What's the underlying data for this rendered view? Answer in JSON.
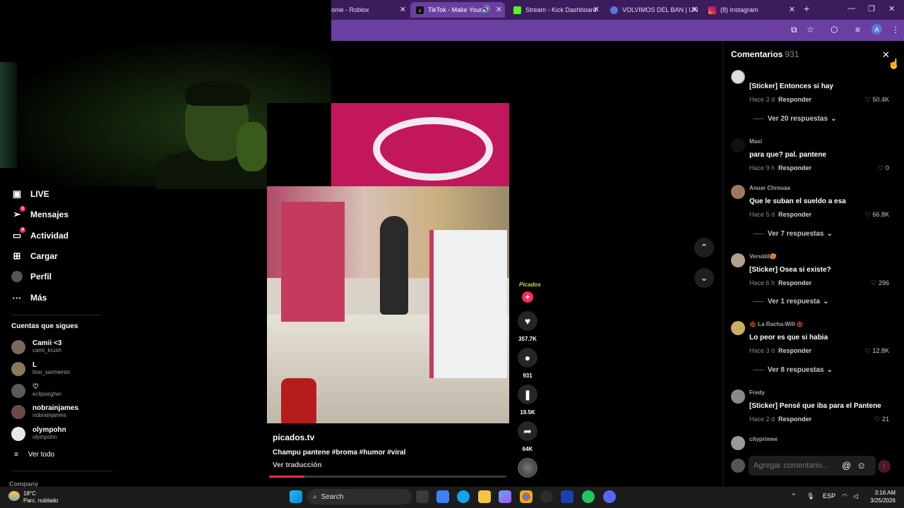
{
  "browser": {
    "tabs": [
      {
        "label": "ome - Roblox",
        "active": false
      },
      {
        "label": "TikTok - Make Your D",
        "active": true
      },
      {
        "label": "Stream - Kick Dashboard",
        "active": false
      },
      {
        "label": "VOLVIMOS DEL BAN | UN",
        "active": false
      },
      {
        "label": "(8) Instagram",
        "active": false
      }
    ],
    "new_tab": "+",
    "profile_initial": "A"
  },
  "sidebar": {
    "items": [
      {
        "label": "LIVE",
        "icon": "live-icon",
        "badge": ""
      },
      {
        "label": "Mensajes",
        "icon": "messages-icon",
        "badge": "1"
      },
      {
        "label": "Actividad",
        "icon": "activity-icon",
        "badge": "4"
      },
      {
        "label": "Cargar",
        "icon": "upload-icon",
        "badge": ""
      },
      {
        "label": "Perfil",
        "icon": "profile-icon",
        "badge": ""
      },
      {
        "label": "Más",
        "icon": "more-icon",
        "badge": ""
      }
    ],
    "following_title": "Cuentas que sigues",
    "following": [
      {
        "name": "Camii <3",
        "username": "cami_krush"
      },
      {
        "name": "L",
        "username": "lissi_sarmiento"
      },
      {
        "name": "♡",
        "username": "eclipsegher"
      },
      {
        "name": "nobrainjames",
        "username": "nobrainjames"
      },
      {
        "name": "olympohn",
        "username": "olympohn"
      }
    ],
    "see_all": "Ver todo",
    "company": "Company"
  },
  "video": {
    "author": "picados.tv",
    "caption": "Champu pantene #broma #humor #viral",
    "translate": "Ver traducción",
    "progress": 0.15,
    "author_avatar_label": "Picados",
    "likes": "357.7K",
    "comments": "931",
    "saves": "19.5K",
    "shares": "64K"
  },
  "comments": {
    "title": "Comentarios",
    "count": "931",
    "reply_label": "Responder",
    "items": [
      {
        "user": "",
        "text": "[Sticker] Entonces si hay",
        "time": "Hace 3 d",
        "likes": "50.4K",
        "replies": "Ver 20 respuestas"
      },
      {
        "user": "Maxi",
        "text": "para que? pal. pantene",
        "time": "Hace 9 h",
        "likes": "0",
        "replies": ""
      },
      {
        "user": "Anuar Chrouaa",
        "text": "Que le suban el sueldo a esa",
        "time": "Hace 5 d",
        "likes": "66.8K",
        "replies": "Ver 7 respuestas"
      },
      {
        "user": "Versátil🥵",
        "text": "[Sticker] Osea si existe?",
        "time": "Hace 6 h",
        "likes": "296",
        "replies": "Ver 1 respuesta"
      },
      {
        "user": "🌰 La Racha-Will 🌰",
        "text": "Lo peor es que si habia",
        "time": "Hace 3 d",
        "likes": "12.8K",
        "replies": "Ver 8 respuestas"
      },
      {
        "user": "Fredy",
        "text": "[Sticker] Pensé que iba para el Pantene",
        "time": "Hace 2 d",
        "likes": "21",
        "replies": ""
      },
      {
        "user": "cityprimee",
        "text": "",
        "time": "",
        "likes": "",
        "replies": ""
      }
    ],
    "input_placeholder": "Agregar comentario..."
  },
  "taskbar": {
    "temp": "18°C",
    "weather": "Parc. nublado",
    "search": "Search",
    "lang": "ESP",
    "time": "3:16 AM",
    "date": "3/25/2026"
  },
  "colors": {
    "accent": "#fe2c55",
    "browser_tab": "#6a3fa0",
    "browser_bg": "#3b1d5e"
  }
}
